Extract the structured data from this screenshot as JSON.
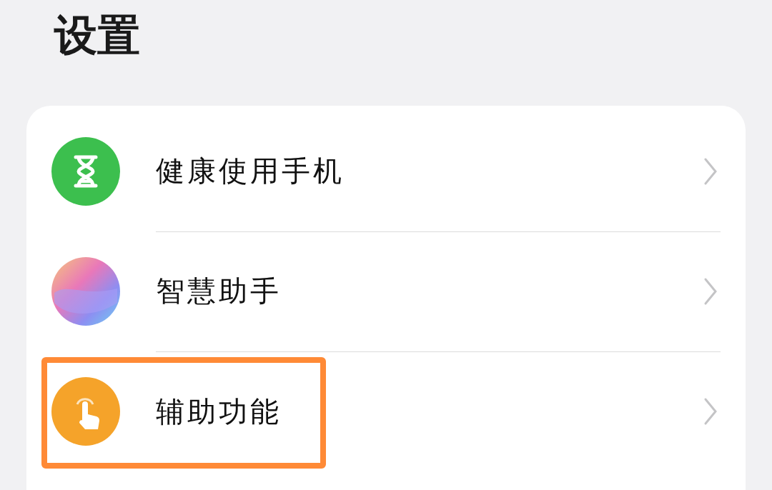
{
  "title": "设置",
  "items": [
    {
      "label": "健康使用手机",
      "kind": "hourglass",
      "highlighted": false
    },
    {
      "label": "智慧助手",
      "kind": "assistant",
      "highlighted": false
    },
    {
      "label": "辅助功能",
      "kind": "hand",
      "highlighted": true
    }
  ]
}
